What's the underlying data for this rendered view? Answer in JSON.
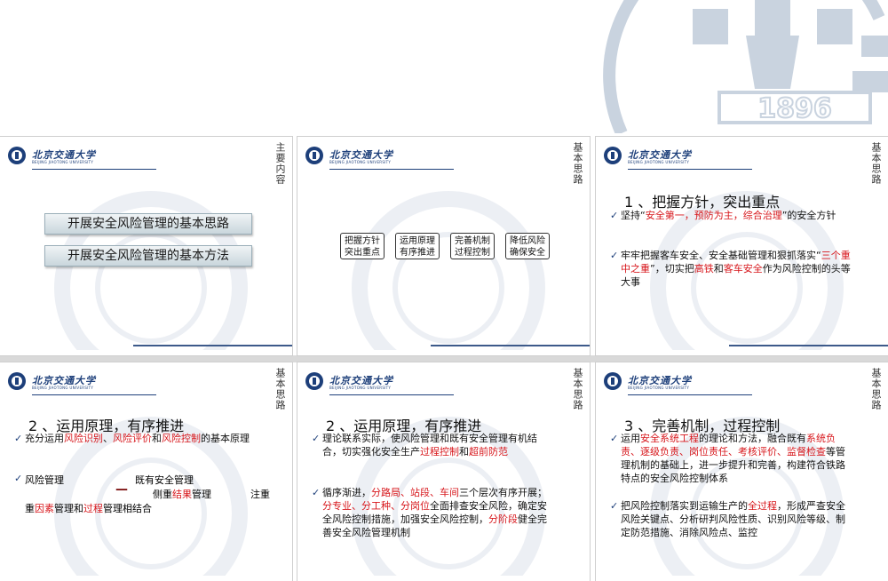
{
  "colors": {
    "accent": "#1d3f7a",
    "highlight": "#d7161b",
    "watermark": "#c9d3df"
  },
  "background_seal": {
    "icon": "university-seal-icon",
    "year": "1896"
  },
  "header": {
    "university_cn": "北京交通大学",
    "university_en": "BEIJING JIAOTONG UNIVERSITY"
  },
  "slides": [
    {
      "side_title": "主要内容",
      "menu": [
        "开展安全风险管理的基本思路",
        "开展安全风险管理的基本方法"
      ]
    },
    {
      "side_title": "基本思路",
      "boxes": [
        [
          "把握方针",
          "突出重点"
        ],
        [
          "运用原理",
          "有序推进"
        ],
        [
          "完善机制",
          "过程控制"
        ],
        [
          "降低风险",
          "确保安全"
        ]
      ]
    },
    {
      "side_title": "基本思路",
      "section_title": "1 、把握方针，突出重点",
      "b1": [
        "坚持“",
        "安全第一，预防为主，综合治理",
        "”的安全方针"
      ],
      "b2": [
        "牢牢把握客车安全、安全基础管理和狠抓落实“",
        "三个重中之重",
        "”，切实把",
        "高铁",
        "和",
        "客车安全",
        "作为风险控制的头等大事"
      ]
    },
    {
      "side_title": "基本思路",
      "section_title": "2 、运用原理，有序推进",
      "b1": [
        "充分运用",
        "风险识别",
        "、",
        "风险评价",
        "和",
        "风险控制",
        "的基本原理"
      ],
      "b2": [
        "风险管理",
        "既有安全管理",
        "侧重",
        "结果",
        "管理",
        "注重",
        "因素",
        "管理和",
        "过程",
        "管理相结合"
      ]
    },
    {
      "side_title": "基本思路",
      "section_title": "2 、运用原理，有序推进",
      "b1": [
        "理论联系实际，使风险管理和既有安全管理有机结合，切实强化安全生产",
        "过程控制",
        "和",
        "超前防范"
      ],
      "b2": [
        "循序渐进，",
        "分路局、站段、车间",
        "三个层次有序开展；",
        "分专业、分工种、分岗位",
        "全面排查安全风险，确定安全风险控制措施，加强安全风险控制，",
        "分阶段",
        "健全完善安全风险管理机制"
      ]
    },
    {
      "side_title": "基本思路",
      "section_title": "3 、完善机制，过程控制",
      "b1": [
        "运用",
        "安全系统工程",
        "的理论和方法，融合既有",
        "系统负责、逐级负责、岗位责任、考核评价、监督检查",
        "等管理机制的基础上，进一步提升和完善，构建符合铁路特点的安全风险控制体系"
      ],
      "b2": [
        "把风险控制落实到运输生产的",
        "全过程",
        "，形成严查安全风险关键点、分析研判风险性质、识别风险等级、制定防范措施、消除风险点、监控"
      ]
    }
  ]
}
